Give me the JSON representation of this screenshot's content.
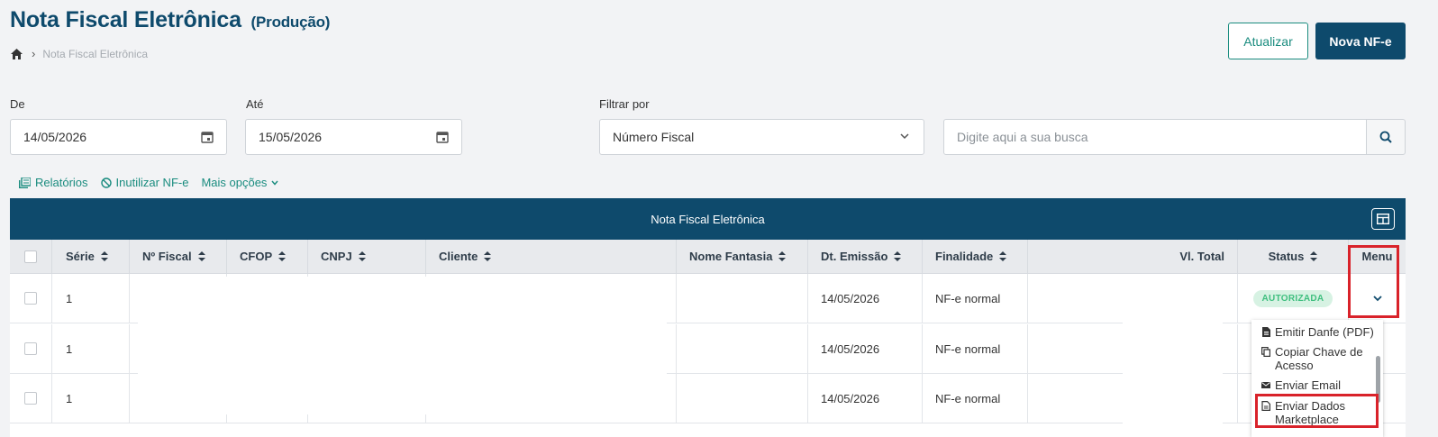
{
  "header": {
    "title": "Nota Fiscal Eletrônica",
    "subtitle": "(Produção)",
    "breadcrumb": "Nota Fiscal Eletrônica",
    "btn_refresh": "Atualizar",
    "btn_new": "Nova NF-e"
  },
  "filters": {
    "from_label": "De",
    "from_value": "14/05/2026",
    "to_label": "Até",
    "to_value": "15/05/2026",
    "filter_label": "Filtrar por",
    "filter_value": "Número Fiscal",
    "search_placeholder": "Digite aqui a sua busca"
  },
  "actions": {
    "reports": "Relatórios",
    "void": "Inutilizar NF-e",
    "more": "Mais opções"
  },
  "table": {
    "title": "Nota Fiscal Eletrônica",
    "columns": {
      "serie": "Série",
      "nfiscal": "Nº Fiscal",
      "cfop": "CFOP",
      "cnpj": "CNPJ",
      "cliente": "Cliente",
      "fantasia": "Nome Fantasia",
      "emissao": "Dt. Emissão",
      "finalidade": "Finalidade",
      "total": "Vl. Total",
      "status": "Status",
      "menu": "Menu"
    },
    "rows": [
      {
        "serie": "1",
        "emissao": "14/05/2026",
        "finalidade": "NF-e normal",
        "status": "AUTORIZADA"
      },
      {
        "serie": "1",
        "emissao": "14/05/2026",
        "finalidade": "NF-e normal",
        "status": ""
      },
      {
        "serie": "1",
        "emissao": "14/05/2026",
        "finalidade": "NF-e normal",
        "status": ""
      }
    ]
  },
  "menu": {
    "items": [
      "Emitir Danfe (PDF)",
      "Copiar Chave de Acesso",
      "Enviar Email",
      "Enviar Dados Marketplace"
    ]
  },
  "colors": {
    "primary": "#0e4a6c",
    "accent": "#1a8c7f",
    "highlight": "#d9222a"
  }
}
